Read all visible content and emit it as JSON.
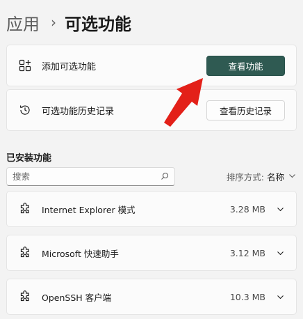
{
  "breadcrumb": {
    "parent": "应用",
    "separator": "›",
    "current": "可选功能"
  },
  "add_card": {
    "label": "添加可选功能",
    "button": "查看功能"
  },
  "history_card": {
    "label": "可选功能历史记录",
    "button": "查看历史记录"
  },
  "installed": {
    "title": "已安装功能",
    "search_placeholder": "搜索",
    "sort_label": "排序方式:",
    "sort_value": "名称",
    "items": [
      {
        "name": "Internet Explorer 模式",
        "size": "3.28 MB"
      },
      {
        "name": "Microsoft 快速助手",
        "size": "3.12 MB"
      },
      {
        "name": "OpenSSH 客户端",
        "size": "10.3 MB"
      }
    ]
  },
  "colors": {
    "accent": "#2f5a52",
    "annotation_arrow": "#e32019"
  }
}
